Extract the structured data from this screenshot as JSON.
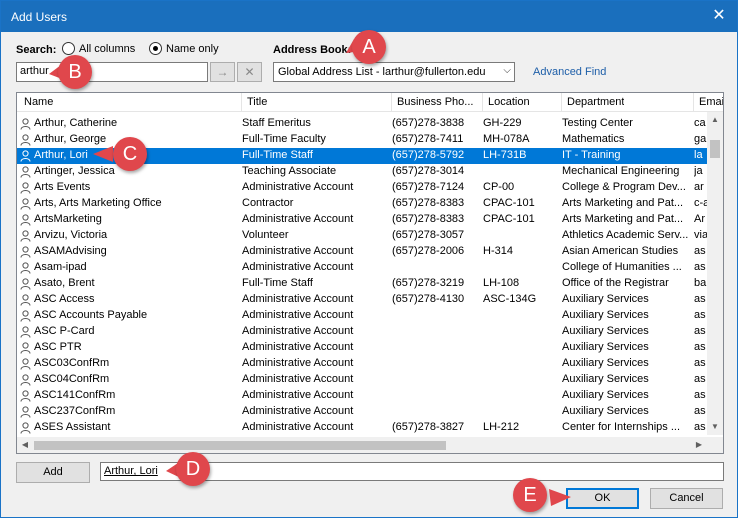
{
  "window": {
    "title": "Add Users"
  },
  "search": {
    "label": "Search:",
    "radio_all": "All columns",
    "radio_name": "Name only",
    "value": "arthur",
    "go_glyph": "→",
    "clear_glyph": "✕"
  },
  "address_book": {
    "label": "Address Book:",
    "value": "Global Address List - larthur@fullerton.edu",
    "advanced_find": "Advanced Find"
  },
  "columns": [
    "Name",
    "Title",
    "Business Pho...",
    "Location",
    "Department",
    "Emai"
  ],
  "rows": [
    {
      "name": "Arthur, Catherine",
      "title": "Staff Emeritus",
      "phone": "(657)278-3838",
      "location": "GH-229",
      "department": "Testing Center",
      "email": "ca"
    },
    {
      "name": "Arthur, George",
      "title": "Full-Time Faculty",
      "phone": "(657)278-7411",
      "location": "MH-078A",
      "department": "Mathematics",
      "email": "ga"
    },
    {
      "name": "Arthur, Lori",
      "title": "Full-Time Staff",
      "phone": "(657)278-5792",
      "location": "LH-731B",
      "department": "IT - Training",
      "email": "la"
    },
    {
      "name": "Artinger, Jessica",
      "title": "Teaching Associate",
      "phone": "(657)278-3014",
      "location": "",
      "department": "Mechanical Engineering",
      "email": "ja"
    },
    {
      "name": "Arts Events",
      "title": "Administrative Account",
      "phone": "(657)278-7124",
      "location": "CP-00",
      "department": "College & Program Dev...",
      "email": "ar"
    },
    {
      "name": "Arts, Arts Marketing Office",
      "title": "Contractor",
      "phone": "(657)278-8383",
      "location": "CPAC-101",
      "department": "Arts Marketing and Pat...",
      "email": "c-a"
    },
    {
      "name": "ArtsMarketing",
      "title": "Administrative Account",
      "phone": "(657)278-8383",
      "location": "CPAC-101",
      "department": "Arts Marketing and Pat...",
      "email": "Ar"
    },
    {
      "name": "Arvizu, Victoria",
      "title": "Volunteer",
      "phone": "(657)278-3057",
      "location": "",
      "department": "Athletics Academic Serv...",
      "email": "via"
    },
    {
      "name": "ASAMAdvising",
      "title": "Administrative Account",
      "phone": "(657)278-2006",
      "location": "H-314",
      "department": "Asian American Studies",
      "email": "as"
    },
    {
      "name": "Asam-ipad",
      "title": "Administrative Account",
      "phone": "",
      "location": "",
      "department": "College of Humanities ...",
      "email": "as"
    },
    {
      "name": "Asato, Brent",
      "title": "Full-Time Staff",
      "phone": "(657)278-3219",
      "location": "LH-108",
      "department": "Office of the Registrar",
      "email": "ba"
    },
    {
      "name": "ASC Access",
      "title": "Administrative Account",
      "phone": "(657)278-4130",
      "location": "ASC-134G",
      "department": "Auxiliary Services",
      "email": "as"
    },
    {
      "name": "ASC Accounts Payable",
      "title": "Administrative Account",
      "phone": "",
      "location": "",
      "department": "Auxiliary Services",
      "email": "as"
    },
    {
      "name": "ASC P-Card",
      "title": "Administrative Account",
      "phone": "",
      "location": "",
      "department": "Auxiliary Services",
      "email": "as"
    },
    {
      "name": "ASC PTR",
      "title": "Administrative Account",
      "phone": "",
      "location": "",
      "department": "Auxiliary Services",
      "email": "as"
    },
    {
      "name": "ASC03ConfRm",
      "title": "Administrative Account",
      "phone": "",
      "location": "",
      "department": "Auxiliary Services",
      "email": "as"
    },
    {
      "name": "ASC04ConfRm",
      "title": "Administrative Account",
      "phone": "",
      "location": "",
      "department": "Auxiliary Services",
      "email": "as"
    },
    {
      "name": "ASC141ConfRm",
      "title": "Administrative Account",
      "phone": "",
      "location": "",
      "department": "Auxiliary Services",
      "email": "as"
    },
    {
      "name": "ASC237ConfRm",
      "title": "Administrative Account",
      "phone": "",
      "location": "",
      "department": "Auxiliary Services",
      "email": "as"
    },
    {
      "name": "ASES Assistant",
      "title": "Administrative Account",
      "phone": "(657)278-3827",
      "location": "LH-212",
      "department": "Center for Internships ...",
      "email": "as"
    }
  ],
  "add": {
    "button": "Add",
    "value": "Arthur, Lori"
  },
  "footer": {
    "ok": "OK",
    "cancel": "Cancel"
  },
  "markers": {
    "a": "A",
    "b": "B",
    "c": "C",
    "d": "D",
    "e": "E"
  },
  "colors": {
    "accent": "#0078d7",
    "titlebar": "#1a6fbd",
    "marker": "#e0474c"
  }
}
